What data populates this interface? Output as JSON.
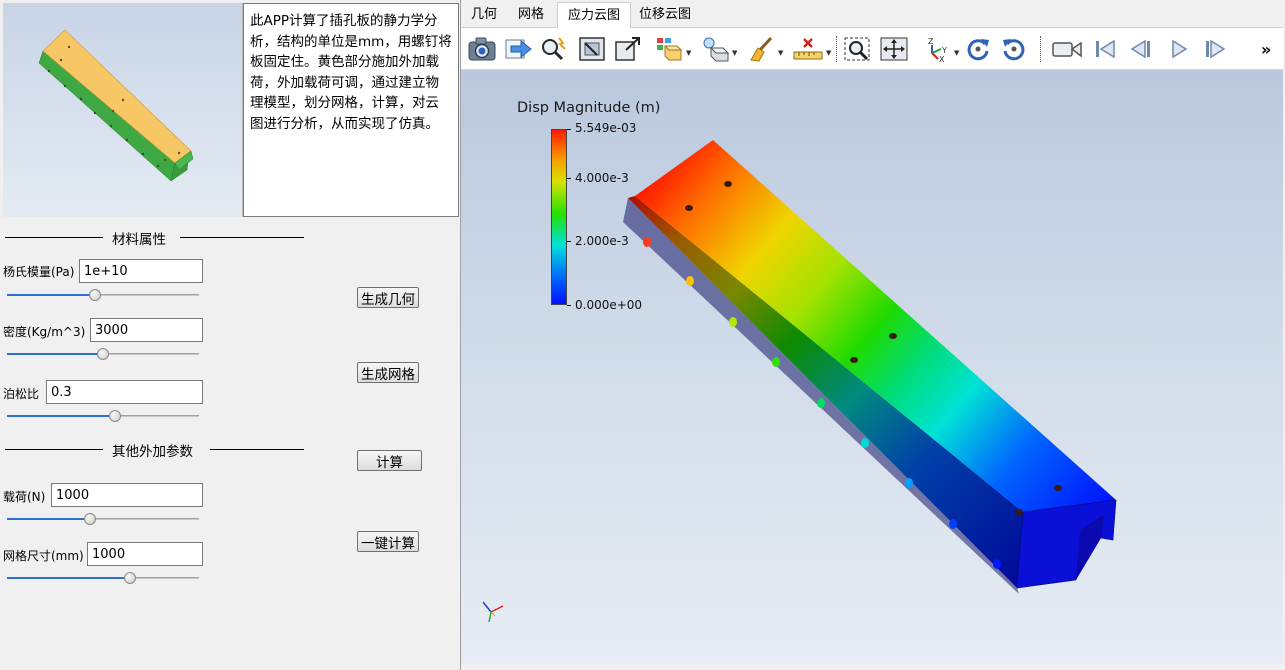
{
  "left": {
    "description": "此APP计算了插孔板的静力学分析，结构的单位是mm，用螺钉将板固定住。黄色部分施加外加载荷，外加载荷可调，通过建立物理模型，划分网格，计算，对云图进行分析，从而实现了仿真。",
    "material_section_title": "材料属性",
    "other_section_title": "其他外加参数",
    "params": {
      "youngs_label": "杨氏模量(Pa)",
      "youngs_value": "1e+10",
      "youngs_slider": 0.46,
      "density_label": "密度(Kg/m^3)",
      "density_value": "3000",
      "density_slider": 0.5,
      "poisson_label": "泊松比",
      "poisson_value": "0.3",
      "poisson_slider": 0.56,
      "load_label": "载荷(N)",
      "load_value": "1000",
      "load_slider": 0.43,
      "mesh_label": "网格尺寸(mm)",
      "mesh_value": "1000",
      "mesh_slider": 0.64
    },
    "buttons": {
      "gen_geometry": "生成几何",
      "gen_mesh": "生成网格",
      "compute": "计算",
      "one_click": "一键计算"
    }
  },
  "tabs": [
    "几何",
    "网格",
    "应力云图",
    "位移云图"
  ],
  "active_tab_index": 2,
  "toolbar": {
    "icons": [
      "camera-icon",
      "export-arrow-icon",
      "zoom-pick-icon",
      "zoom-fit-icon",
      "zoom-box-icon",
      "representation-icon",
      "lighting-icon",
      "broom-clear-icon",
      "ruler-measure-icon",
      "zoom-select-icon",
      "pan-move-icon",
      "axes-orient-icon",
      "rotate-cw-icon",
      "rotate-ccw-icon",
      "video-record-icon",
      "first-frame-icon",
      "prev-frame-icon",
      "play-icon",
      "next-frame-icon",
      "overflow-icon"
    ],
    "overflow_label": "»"
  },
  "legend": {
    "title": "Disp Magnitude (m)",
    "max_label": "5.549e-03",
    "mid_high_label": "4.000e-3",
    "mid_low_label": "2.000e-3",
    "min_label": "0.000e+00"
  },
  "colors": {
    "beam_yellow": "#f9c86a",
    "beam_green": "#3cb043",
    "accent_blue": "#2e6fd6"
  }
}
